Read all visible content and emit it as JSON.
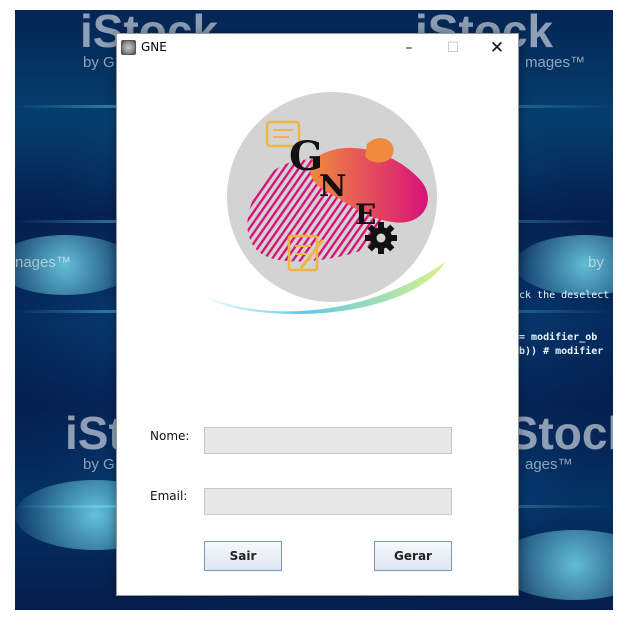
{
  "wallpaper": {
    "marks": [
      "iStock",
      "iStock",
      "iStock",
      "iStock"
    ],
    "subtexts": [
      "by G",
      "mages™",
      "nages™",
      "by",
      "by G",
      "ages™"
    ],
    "code_lines": [
      "ck the deselect",
      "= modifier_ob",
      "b)) # modifier"
    ]
  },
  "window": {
    "title": "GNE",
    "controls": {
      "minimize": "–",
      "maximize": "☐",
      "close": "✕"
    },
    "logo": {
      "letters": [
        "G",
        "N",
        "E"
      ]
    },
    "form": {
      "nome_label": "Nome:",
      "nome_value": "",
      "email_label": "Email:",
      "email_value": ""
    },
    "buttons": {
      "exit": "Sair",
      "generate": "Gerar"
    }
  },
  "colors": {
    "logo_circle": "#d3d3d3",
    "logo_magenta": "#d8127a",
    "logo_orange": "#f08a3e",
    "logo_yellow": "#f2b441",
    "brush_cyan": "#7fe0e6",
    "button_border": "#7f95b4"
  }
}
